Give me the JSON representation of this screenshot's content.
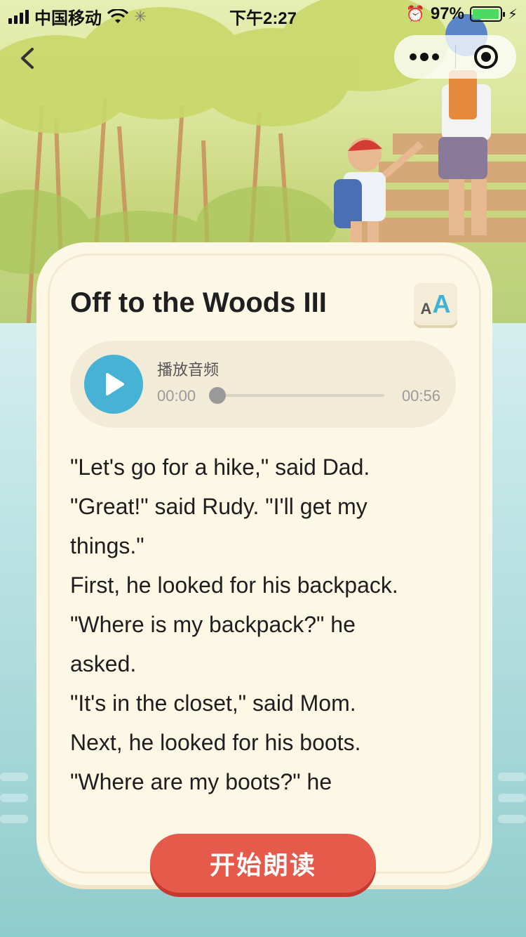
{
  "status_bar": {
    "carrier": "中国移动",
    "time": "下午2:27",
    "battery_percent": "97%",
    "battery_level": 0.97
  },
  "nav": {
    "back_icon": "chevron-left-icon",
    "more_icon": "more-dots-icon",
    "close_icon": "target-circle-icon"
  },
  "lesson": {
    "title": "Off to the Woods III",
    "font_size_button": {
      "small": "A",
      "big": "A"
    }
  },
  "audio": {
    "label": "播放音频",
    "current_time": "00:00",
    "duration": "00:56",
    "progress": 0
  },
  "story": {
    "lines": [
      "\"Let's go for a hike,\" said Dad.",
      "\"Great!\" said Rudy. \"I'll get my",
      "things.\"",
      "First, he looked for his backpack.",
      "\"Where is my backpack?\" he",
      "asked.",
      "\"It's in the closet,\" said Mom.",
      "Next, he looked for his boots.",
      "\"Where are my boots?\" he"
    ]
  },
  "actions": {
    "start_reading": "开始朗读"
  },
  "colors": {
    "accent_blue": "#46b2d4",
    "button_red": "#e65a4c",
    "card_bg": "#fdf7e6",
    "battery_green": "#4cd964"
  }
}
